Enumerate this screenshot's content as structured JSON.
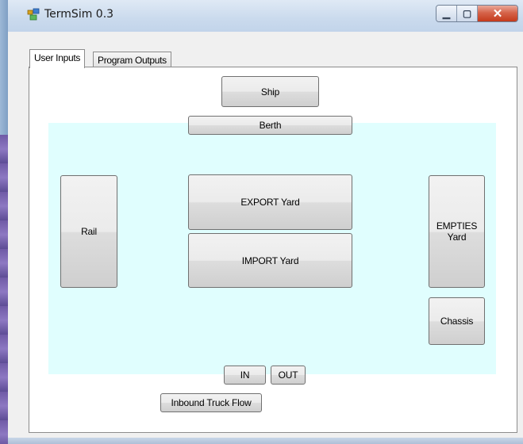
{
  "window": {
    "title": "TermSim 0.3",
    "icon": "app-window-icon",
    "minimize_glyph": "▁",
    "maximize_glyph": "▢",
    "close_glyph": "✕"
  },
  "tabs": [
    {
      "label": "User Inputs",
      "active": true
    },
    {
      "label": "Program Outputs",
      "active": false
    }
  ],
  "colors": {
    "terminal_area": "#e0fefe",
    "close_button": "#c43a1b"
  },
  "buttons": {
    "ship": "Ship",
    "berth": "Berth",
    "rail": "Rail",
    "export_yard": "EXPORT Yard",
    "import_yard": "IMPORT Yard",
    "empties_yard": "EMPTIES\nYard",
    "chassis": "Chassis",
    "in": "IN",
    "out": "OUT",
    "inbound_truck_flow": "Inbound Truck Flow"
  }
}
